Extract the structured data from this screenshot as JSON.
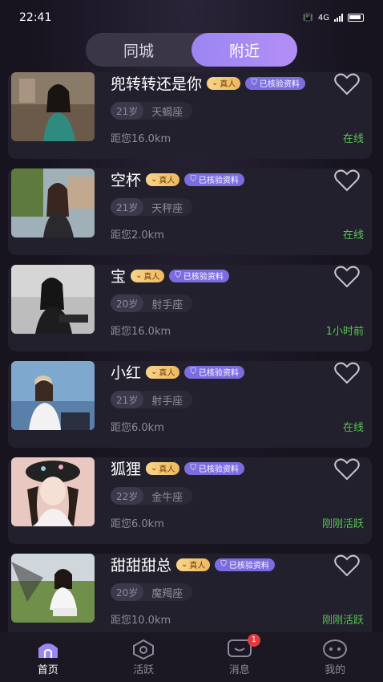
{
  "status_bar": {
    "time": "22:41",
    "network": "4G"
  },
  "tabs": [
    {
      "label": "同城",
      "active": false
    },
    {
      "label": "附近",
      "active": true
    }
  ],
  "badges": {
    "real": "真人",
    "verified": "已核验资料"
  },
  "cards": [
    {
      "name": "兜转转还是你",
      "age": "21岁",
      "star": "天蝎座",
      "distance": "距您16.0km",
      "status": "在线"
    },
    {
      "name": "空杯",
      "age": "21岁",
      "star": "天秤座",
      "distance": "距您2.0km",
      "status": "在线"
    },
    {
      "name": "宝",
      "age": "20岁",
      "star": "射手座",
      "distance": "距您16.0km",
      "status": "1小时前"
    },
    {
      "name": "小红",
      "age": "21岁",
      "star": "射手座",
      "distance": "距您6.0km",
      "status": "在线"
    },
    {
      "name": "狐狸",
      "age": "22岁",
      "star": "金牛座",
      "distance": "距您6.0km",
      "status": "刚刚活跃"
    },
    {
      "name": "甜甜甜总",
      "age": "20岁",
      "star": "魔羯座",
      "distance": "距您10.0km",
      "status": "刚刚活跃"
    }
  ],
  "nav": [
    {
      "label": "首页",
      "icon": "home-icon",
      "active": true
    },
    {
      "label": "活跃",
      "icon": "activity-icon",
      "active": false
    },
    {
      "label": "消息",
      "icon": "message-icon",
      "active": false,
      "badge": "1"
    },
    {
      "label": "我的",
      "icon": "profile-icon",
      "active": false
    }
  ],
  "colors": {
    "accent": "#9b86f2",
    "online": "#54c651",
    "badge_red": "#e23b3b"
  }
}
